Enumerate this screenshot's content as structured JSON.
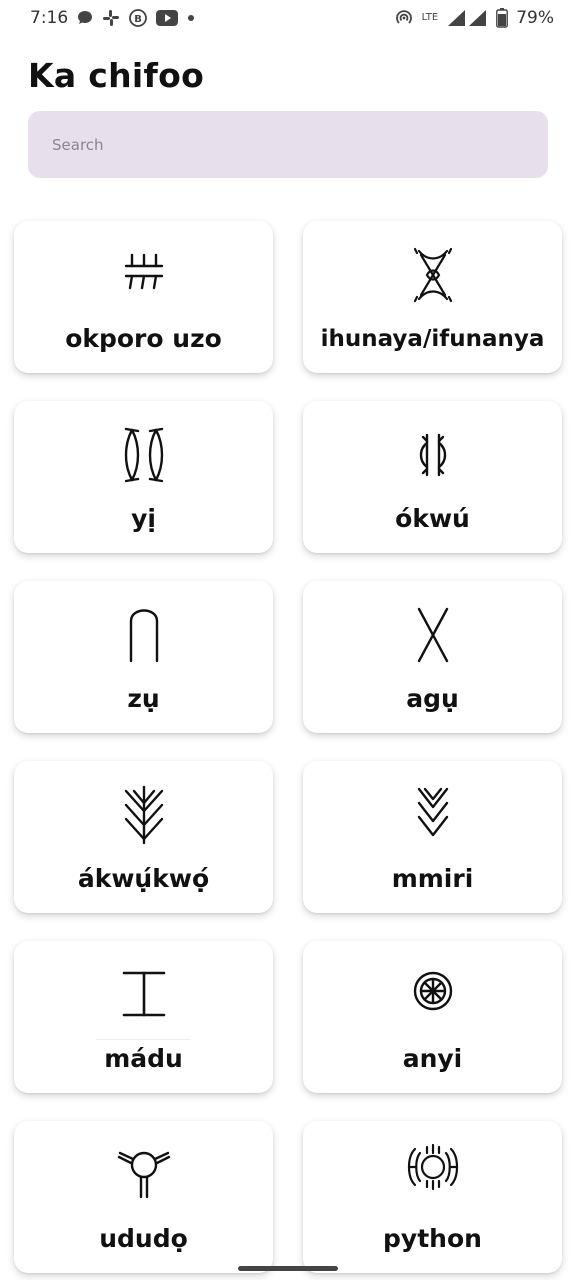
{
  "status_bar": {
    "time": "7:16",
    "network": "LTE",
    "battery": "79%",
    "icons": [
      "message-icon",
      "slack-icon",
      "b-icon",
      "youtube-icon",
      "dot-icon",
      "hotspot-icon",
      "signal-icon",
      "battery-icon"
    ]
  },
  "header": {
    "title": "Ka chifoo"
  },
  "search": {
    "placeholder": "Search",
    "value": ""
  },
  "cards": [
    {
      "label": "okporo uzo",
      "icon": "okporo-uzo-symbol"
    },
    {
      "label": "ihunaya/ifunanya",
      "icon": "ihunaya-symbol"
    },
    {
      "label": "yị",
      "icon": "yi-symbol"
    },
    {
      "label": "ókwú",
      "icon": "okwu-symbol"
    },
    {
      "label": "zụ",
      "icon": "zu-symbol"
    },
    {
      "label": "agụ",
      "icon": "agu-symbol"
    },
    {
      "label": "ákwụ́kwọ́",
      "icon": "akwukwo-symbol"
    },
    {
      "label": "mmiri",
      "icon": "mmiri-symbol"
    },
    {
      "label": "mádu",
      "icon": "madu-symbol"
    },
    {
      "label": "anyi",
      "icon": "anyi-symbol"
    },
    {
      "label": "ududọ",
      "icon": "ududo-symbol"
    },
    {
      "label": "python",
      "icon": "python-symbol"
    }
  ],
  "colors": {
    "search_bg": "#e7e0ec",
    "card_bg": "#ffffff",
    "text": "#111111"
  }
}
